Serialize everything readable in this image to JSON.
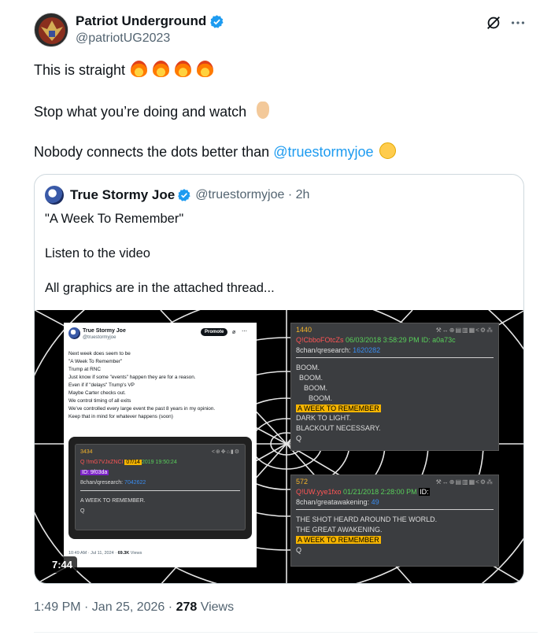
{
  "author": {
    "display_name": "Patriot Underground",
    "handle": "@patriotUG2023"
  },
  "header_icons": {
    "grok": "grok-icon",
    "more": "more-icon"
  },
  "tweet": {
    "line1": "This is straight",
    "line2": "Stop what you’re doing and watch",
    "line3_prefix": "Nobody connects the dots better than",
    "line3_mention": "@truestormyjoe"
  },
  "quote": {
    "display_name": "True Stormy Joe",
    "handle_time": "@truestormyjoe · 2h",
    "line1": "\"A Week To Remember\"",
    "line2": "Listen to the video",
    "line3": "All graphics are in the attached thread..."
  },
  "video": {
    "duration": "7:44",
    "screenshot": {
      "name": "True Stormy Joe",
      "handle": "@truestormyjoe",
      "promote": "Promote",
      "lines": [
        "Next week does seem to be",
        "\"A Week To Remember\"",
        "Trump at RNC",
        "Just know if some \"events\" happen they are for a reason.",
        "Even if if \"delays\" Trump's VP",
        "Maybe Carter checks out.",
        "We control timing of all exits",
        "We've controlled every large event the past 8 years in my opinion.",
        "Keep that in mind for whatever happens (soon)"
      ],
      "post_num": "3434",
      "post_q": "Q",
      "post_trip": "!!mG7VJxZNCI",
      "post_date_tag": "07/14",
      "post_date": "2019 19:50:24",
      "post_id": "ID: 9f03da",
      "post_board": "8chan/qresearch:",
      "post_ref": "7042622",
      "post_body": "A WEEK TO REMEMBER.",
      "post_sign": "Q",
      "footer_time": "10:49 AM · Jul 11, 2024 ·",
      "footer_views": "69.3K",
      "footer_views_label": "Views"
    },
    "post1": {
      "num": "1440",
      "q": "Q",
      "trip": "!CbboFOtcZs",
      "date": "06/03/2018 3:58:29 PM",
      "id": "ID: a0a73c",
      "board": "8chan/qresearch:",
      "ref": "1620282",
      "boom1": "BOOM.",
      "boom2": "BOOM.",
      "boom3": "BOOM.",
      "boom4": "BOOM.",
      "tag": "A WEEK TO REMEMBER",
      "line1": "DARK TO LIGHT.",
      "line2": "BLACKOUT NECESSARY.",
      "sign": "Q"
    },
    "post2": {
      "num": "572",
      "q": "Q",
      "trip": "!UW.yye1fxo",
      "date": "01/21/2018 2:28:00 PM",
      "id": "ID:",
      "board": "8chan/greatawakening:",
      "ref": "49",
      "line1": "THE SHOT HEARD AROUND THE WORLD.",
      "line2": "THE GREAT AWAKENING.",
      "tag": "A WEEK TO REMEMBER",
      "sign": "Q"
    }
  },
  "meta": {
    "time": "1:49 PM · Jan 25, 2026 ·",
    "views": "278",
    "views_label": "Views"
  },
  "colors": {
    "mention": "#1d9bf0",
    "verified": "#1d9bf0",
    "tag_yellow": "#f5b400"
  }
}
